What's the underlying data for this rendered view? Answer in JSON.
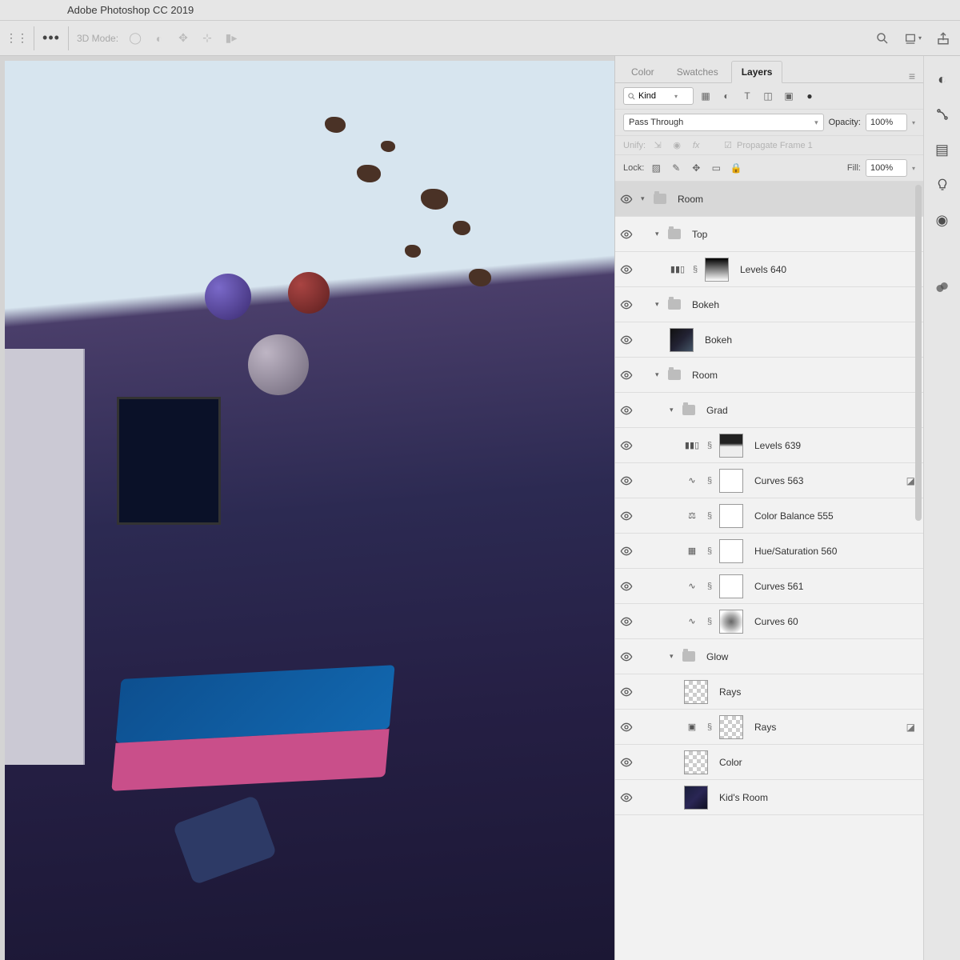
{
  "app": {
    "title": "Adobe Photoshop CC 2019"
  },
  "options_bar": {
    "mode_label": "3D Mode:"
  },
  "panels": {
    "tabs": {
      "color": "Color",
      "swatches": "Swatches",
      "layers": "Layers"
    },
    "kind_search": "Kind",
    "blend_mode": "Pass Through",
    "opacity_label": "Opacity:",
    "opacity_value": "100%",
    "unify_label": "Unify:",
    "propagate_label": "Propagate Frame 1",
    "lock_label": "Lock:",
    "fill_label": "Fill:",
    "fill_value": "100%"
  },
  "layers": [
    {
      "name": "Room",
      "type": "group",
      "indent": 0,
      "open": true,
      "selected": true
    },
    {
      "name": "Top",
      "type": "group",
      "indent": 1,
      "open": true
    },
    {
      "name": "Levels 640",
      "type": "adj",
      "indent": 2,
      "adj": "levels",
      "thumb": "grad-v"
    },
    {
      "name": "Bokeh",
      "type": "group",
      "indent": 1,
      "open": true
    },
    {
      "name": "Bokeh",
      "type": "layer",
      "indent": 2,
      "thumb": "photo"
    },
    {
      "name": "Room",
      "type": "group",
      "indent": 1,
      "open": true
    },
    {
      "name": "Grad",
      "type": "group",
      "indent": 2,
      "open": true
    },
    {
      "name": "Levels 639",
      "type": "adj",
      "indent": 3,
      "adj": "levels",
      "thumb": "grad-h"
    },
    {
      "name": "Curves 563",
      "type": "adj",
      "indent": 3,
      "adj": "curves",
      "thumb": "white",
      "clip": true
    },
    {
      "name": "Color Balance 555",
      "type": "adj",
      "indent": 3,
      "adj": "balance",
      "thumb": "white"
    },
    {
      "name": "Hue/Saturation 560",
      "type": "adj",
      "indent": 3,
      "adj": "hue",
      "thumb": "white"
    },
    {
      "name": "Curves 561",
      "type": "adj",
      "indent": 3,
      "adj": "curves",
      "thumb": "white"
    },
    {
      "name": "Curves 60",
      "type": "adj",
      "indent": 3,
      "adj": "curves",
      "thumb": "blur"
    },
    {
      "name": "Glow",
      "type": "group",
      "indent": 2,
      "open": true
    },
    {
      "name": "Rays",
      "type": "layer",
      "indent": 3,
      "thumb": "checker"
    },
    {
      "name": "Rays",
      "type": "adj",
      "indent": 3,
      "adj": "smart",
      "thumb": "checker",
      "clip": true
    },
    {
      "name": "Color",
      "type": "layer",
      "indent": 3,
      "thumb": "checker"
    },
    {
      "name": "Kid's Room",
      "type": "layer",
      "indent": 3,
      "thumb": "photo2"
    }
  ]
}
